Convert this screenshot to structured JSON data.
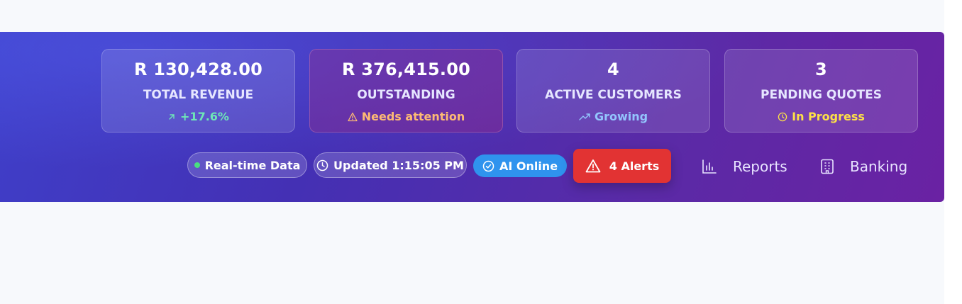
{
  "stats": [
    {
      "value": "R 130,428.00",
      "label": "TOTAL REVENUE",
      "sub": "+17.6%",
      "sub_color": "#6ee7b7",
      "icon": "arrow-up-right-icon"
    },
    {
      "value": "R 376,415.00",
      "label": "OUTSTANDING",
      "sub": "Needs attention",
      "sub_color": "#fdba74",
      "icon": "warning-icon"
    },
    {
      "value": "4",
      "label": "ACTIVE CUSTOMERS",
      "sub": "Growing",
      "sub_color": "#93c5fd",
      "icon": "trending-up-icon"
    },
    {
      "value": "3",
      "label": "PENDING QUOTES",
      "sub": "In Progress",
      "sub_color": "#fde047",
      "icon": "clock-icon"
    }
  ],
  "status": {
    "realtime": "Real-time Data",
    "updated": "Updated 1:15:05 PM",
    "ai": "AI Online",
    "alerts": "4 Alerts"
  },
  "nav": {
    "reports": "Reports",
    "banking": "Banking"
  },
  "colors": {
    "banner_start": "#3f3fc9",
    "banner_end": "#6a22a3",
    "alert_red": "#e23333",
    "ai_blue": "#2f93ee",
    "live_green": "#4ade80"
  }
}
